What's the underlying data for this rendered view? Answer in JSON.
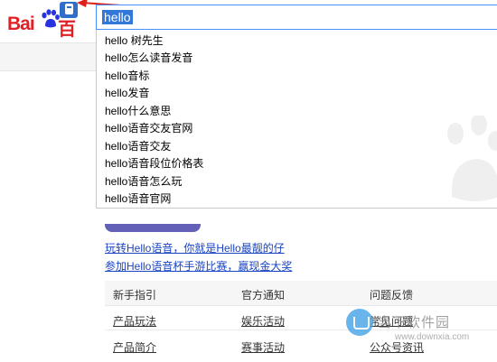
{
  "logo": {
    "text_left": "Bai",
    "text_right": "百度"
  },
  "search": {
    "query": "hello"
  },
  "suggestions": [
    "hello 树先生",
    "hello怎么读音发音",
    "hello音标",
    "hello发音",
    "hello什么意思",
    "hello语音交友官网",
    "hello语音交友",
    "hello语音段位价格表",
    "hello语音怎么玩",
    "hello语音官网"
  ],
  "links": [
    "玩转Hello语音，你就是Hello最靓的仔",
    "参加Hello语音杯手游比赛，赢现金大奖"
  ],
  "table": {
    "headers": [
      "新手指引",
      "官方通知",
      "问题反馈"
    ],
    "rows": [
      [
        "产品玩法",
        "娱乐活动",
        "常见问题"
      ],
      [
        "产品简介",
        "赛事活动",
        "公众号资讯"
      ]
    ]
  },
  "watermark": {
    "title": "当下软件园",
    "url": "www.downxia.com"
  },
  "colors": {
    "accent": "#4791ff",
    "brand": "#e12025",
    "arrow": "#e0201c",
    "link": "#1a44c4"
  }
}
